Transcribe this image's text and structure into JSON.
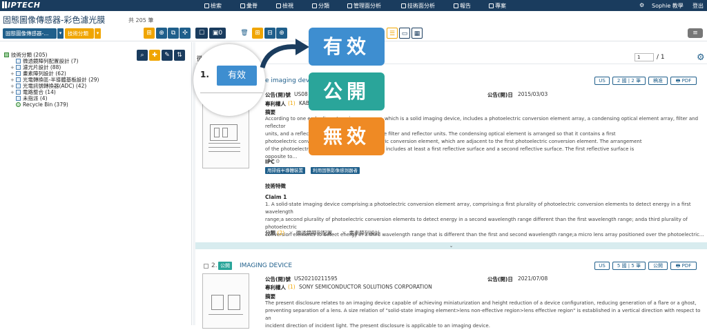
{
  "nav": {
    "logo": "IPTECH",
    "items": [
      {
        "icon": "search-icon",
        "label": "檢索"
      },
      {
        "icon": "star-icon",
        "label": "彙脊"
      },
      {
        "icon": "monitor-icon",
        "label": "檢視"
      },
      {
        "icon": "branch-icon",
        "label": "分類"
      },
      {
        "icon": "monitor-icon",
        "label": "管理面分析"
      },
      {
        "icon": "gear-icon",
        "label": "技術面分析"
      },
      {
        "icon": "doc-icon",
        "label": "報告"
      },
      {
        "icon": "folder-icon",
        "label": "專案"
      }
    ],
    "user": "Sophie 教學",
    "logout": "登出"
  },
  "page": {
    "title": "固態圖像傳感器-彩色濾光膜",
    "count": "共 205 筆"
  },
  "toolbar": {
    "dropdown1": "固態圖像傳感器-...",
    "dropdown2": "技術分類"
  },
  "tree": {
    "items": [
      {
        "label": "技術分類 (205)",
        "level": 0,
        "type": "root",
        "expander": ""
      },
      {
        "label": "微透鏡陣列配置設計 (7)",
        "level": 1,
        "type": "folder",
        "expander": ""
      },
      {
        "label": "濾光片設計 (88)",
        "level": 1,
        "type": "folder",
        "expander": "+"
      },
      {
        "label": "畫素陣列設計 (62)",
        "level": 1,
        "type": "folder",
        "expander": "+"
      },
      {
        "label": "光電轉換區-半導體基板設計 (29)",
        "level": 1,
        "type": "folder",
        "expander": "+"
      },
      {
        "label": "光電訊號轉換器(ADC) (42)",
        "level": 1,
        "type": "folder",
        "expander": "+"
      },
      {
        "label": "電路整合 (14)",
        "level": 1,
        "type": "folder",
        "expander": "+"
      },
      {
        "label": "未指派 (4)",
        "level": 1,
        "type": "folder",
        "expander": ""
      },
      {
        "label": "Recycle Bin (379)",
        "level": 1,
        "type": "bin",
        "expander": ""
      }
    ]
  },
  "results": {
    "label": "微",
    "page_input": "1",
    "page_total": "/ 1",
    "cards": [
      {
        "index": "1.",
        "status": "有效",
        "title_fragment": "e imaging device",
        "pub_no_label": "公告(開)號",
        "pub_no": "US08",
        "pub_date_label": "公告(開)日",
        "pub_date": "2015/03/03",
        "assignee_label": "專利權人",
        "assignee_count": "(1)",
        "assignee": "KAB",
        "abstract_label": "摘要",
        "abstract_lines": [
          "According to one embodiment, an image sensor, which is a solid imaging device, includes a photoelectric conversion element array, a condensing optical element array, filter and reflector",
          "units, and a reflect                                            reflects a light reflected by the filter and reflector units. The condensing optical element is arranged so that it contains a first",
          "photoelectric conve                                    second or a third photoelectric conversion element, which are adjacent to the first photoelectric conversion element. The arrangement",
          "of the photoelectric                                        rise a cell. The reflective unit includes at least a first reflective surface and a second reflective surface. The first reflective surface is",
          "opposite to…"
        ],
        "ipc_label": "IPC",
        "ipc_chips": [
          "用掃描半導體裝置",
          "利用固態影像感測器者"
        ],
        "tech_label": "技術特徵",
        "claim_label": "Claim 1",
        "claim_lines": [
          "1. A solid-state imaging device comprising:a photoelectric conversion element array, comprising:a first plurality of photoelectric conversion elements to detect energy in a first wavelength",
          "range;a second plurality of photoelectric conversion elements to detect energy in a second wavelength range different than the first wavelength range; anda third plurality of photoelectric",
          "conversion elements to detect energy in a third wavelength range that is different than the first and second wavelength range;a micro lens array positioned over the photoelectric…"
        ],
        "class_label": "分類",
        "class_count": "(2)",
        "classes": [
          "微透鏡陣列配置…",
          "畫素陣列設計"
        ],
        "buttons": [
          "US",
          "2 國 | 2 筆",
          "稿准",
          "PDF"
        ]
      },
      {
        "index": "2.",
        "status": "公開",
        "title": "IMAGING DEVICE",
        "pub_no_label": "公告(開)號",
        "pub_no": "US20210211595",
        "pub_date_label": "公告(開)日",
        "pub_date": "2021/07/08",
        "assignee_label": "專利權人",
        "assignee_count": "(1)",
        "assignee": "SONY SEMICONDUCTOR SOLUTIONS CORPORATION",
        "abstract_label": "摘要",
        "abstract_lines": [
          "The present disclosure relates to an imaging device capable of achieving miniaturization and height reduction of a device configuration, reducing generation of a flare or a ghost,",
          "preventing separation of a lens. A size relation of \"solid-state imaging element>lens non-effective region>lens effective region\" is established in a vertical direction with respect to an",
          "incident direction of incident light. The present disclosure is applicable to an imaging device."
        ],
        "buttons": [
          "US",
          "5 國 | 5 筆",
          "公開",
          "PDF"
        ]
      }
    ]
  },
  "overlay": {
    "magnifier_index": "1.",
    "magnifier_status": "有效",
    "labels": [
      {
        "text": "有效",
        "color": "#3e8ed0"
      },
      {
        "text": "公開",
        "color": "#2aa59a"
      },
      {
        "text": "無效",
        "color": "#ef8a24"
      }
    ]
  }
}
